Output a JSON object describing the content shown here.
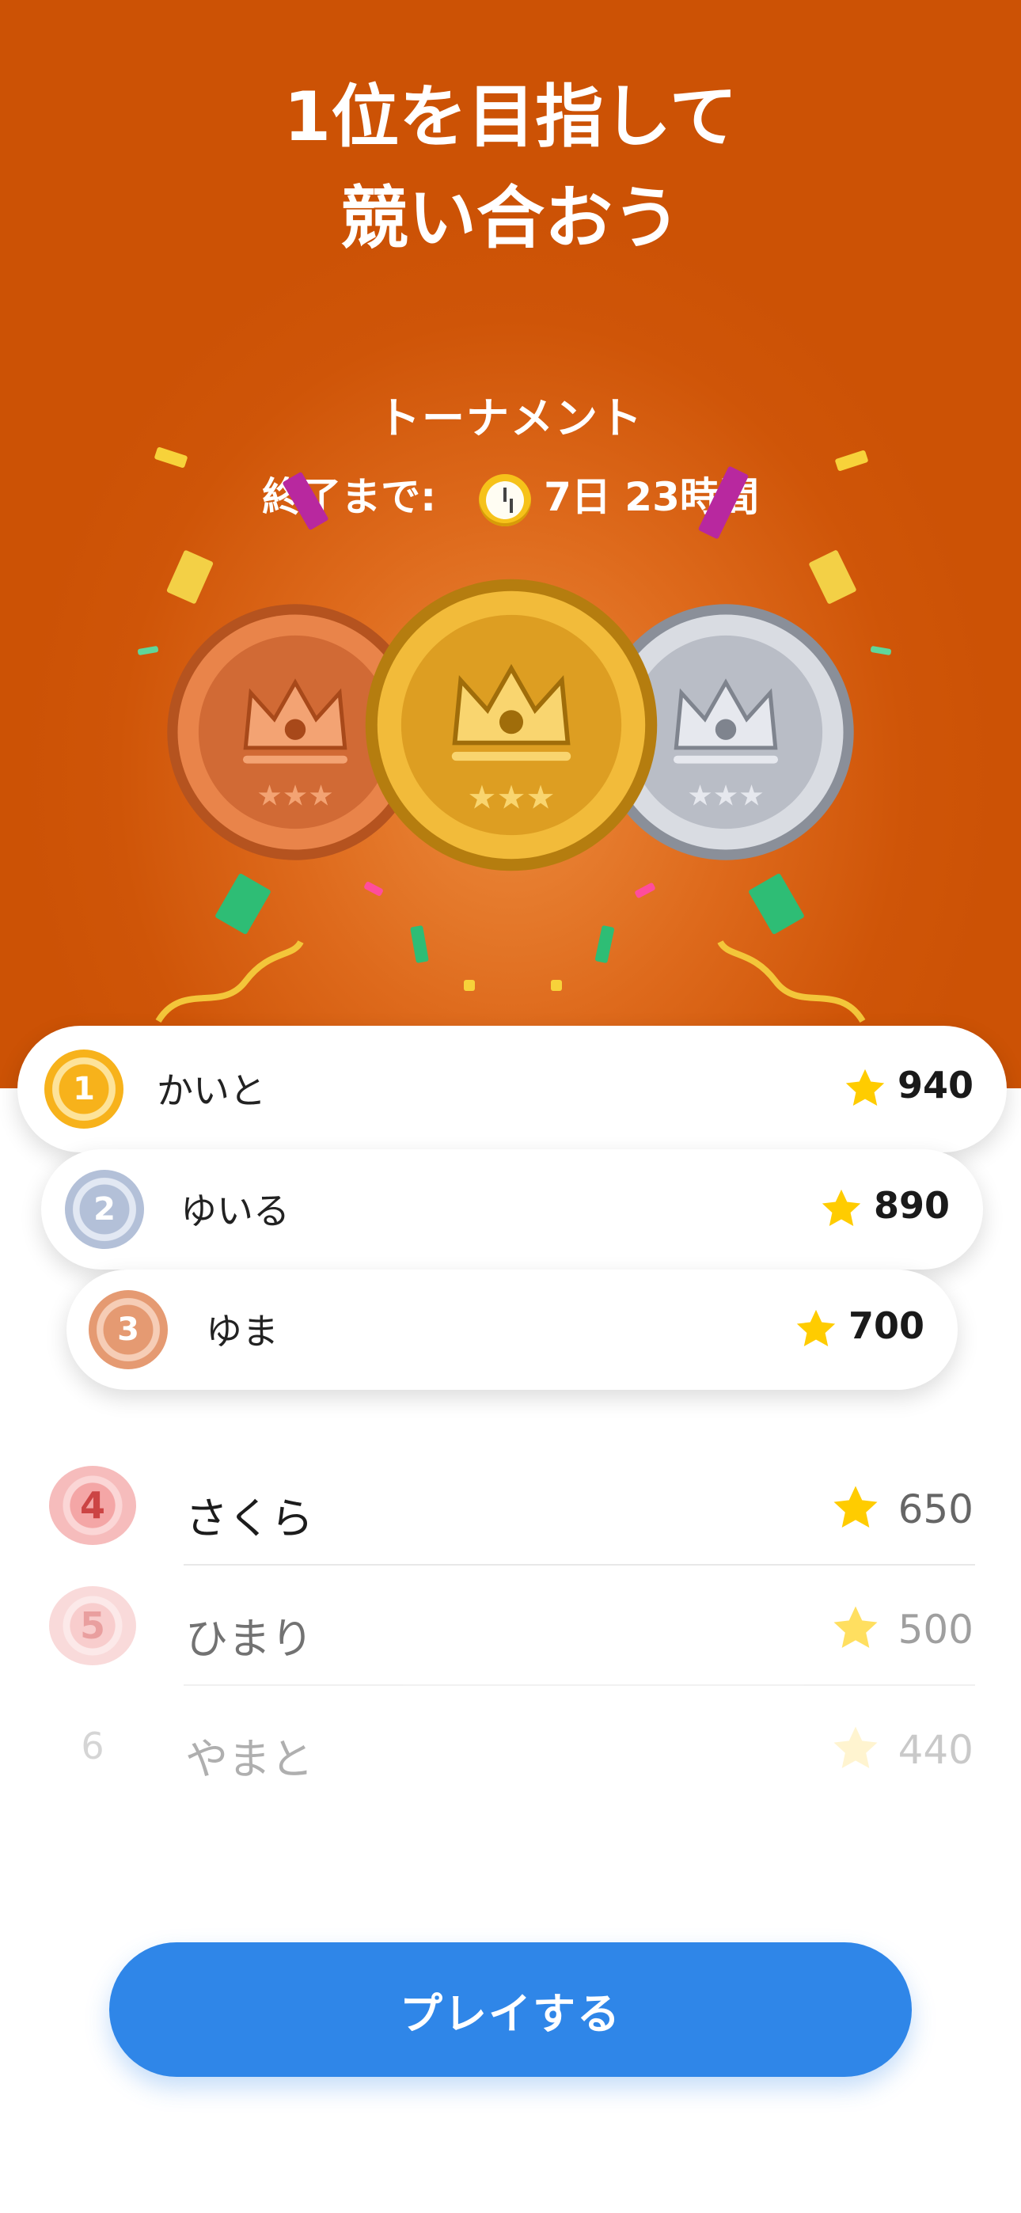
{
  "header": {
    "headline_line1": "1位を目指して",
    "headline_line2": "競い合おう",
    "subtitle": "トーナメント",
    "countdown_label": "終了まで:",
    "countdown_value": "7日 23時間"
  },
  "podium": [
    {
      "rank": "1",
      "name": "かいと",
      "score": "940",
      "badge_color": "#f3a51a"
    },
    {
      "rank": "2",
      "name": "ゆいる",
      "score": "890",
      "badge_color": "#b3c0d8"
    },
    {
      "rank": "3",
      "name": "ゆま",
      "score": "700",
      "badge_color": "#e59a72"
    }
  ],
  "leaderboard": [
    {
      "rank": "4",
      "name": "さくら",
      "score": "650"
    },
    {
      "rank": "5",
      "name": "ひまり",
      "score": "500"
    },
    {
      "rank": "6",
      "name": "やまと",
      "score": "440"
    }
  ],
  "play_button": {
    "label": "プレイする"
  },
  "colors": {
    "hero_orange": "#cf5508",
    "accent_blue": "#2f86e8",
    "star_yellow": "#ffcc00"
  }
}
